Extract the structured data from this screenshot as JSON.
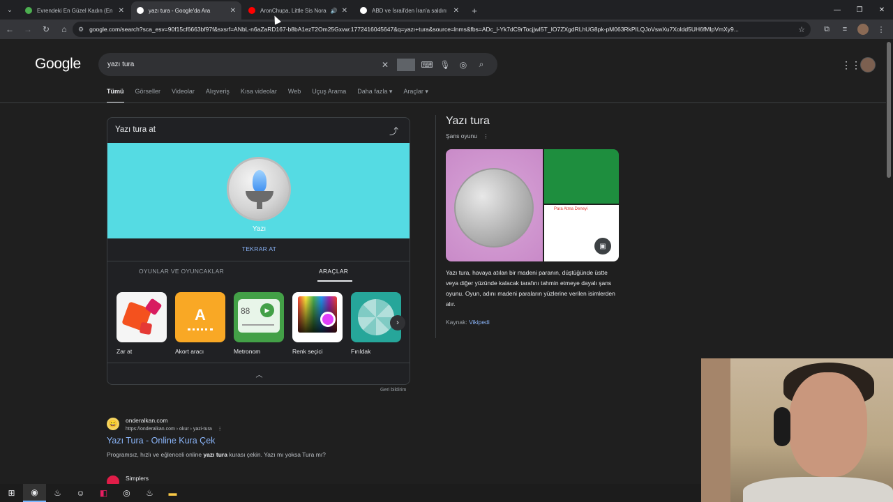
{
  "browser": {
    "tabs": [
      {
        "title": "Evrendeki En Güzel Kadın (En G",
        "favicon_color": "#4caf50",
        "active": false
      },
      {
        "title": "yazı tura - Google'da Ara",
        "favicon_color": "#ffffff",
        "active": true
      },
      {
        "title": "AronChupa, Little Sis Nora",
        "favicon_color": "#ff0000",
        "active": false,
        "audio": true
      },
      {
        "title": "ABD ve İsrail'den İran'a saldırı",
        "favicon_color": "#ffffff",
        "active": false
      }
    ],
    "url": "google.com/search?sca_esv=90f15cf6663bf97f&sxsrf=ANbL-n6aZaRD167-b8bA1ezT2Om25Gxvw:1772416045647&q=yazı+tura&source=lnms&fbs=ADc_l-Yk7dC9rTocjjwI5T_IO7ZXgdRLhUG8pk-pM063RkPILQJoVswXu7Xoldd5UH6fMIpVmXy9..."
  },
  "google": {
    "logo": "Google",
    "query": "yazı tura",
    "nav_tabs": [
      "Tümü",
      "Görseller",
      "Videolar",
      "Alışveriş",
      "Kısa videolar",
      "Web",
      "Uçuş Arama",
      "Daha fazla ▾",
      "Araçlar ▾"
    ]
  },
  "coin_card": {
    "title": "Yazı tura at",
    "result_label": "Yazı",
    "again_button": "TEKRAR AT",
    "tabs": [
      "OYUNLAR VE OYUNCAKLAR",
      "ARAÇLAR"
    ],
    "tools": [
      {
        "label": "Zar at",
        "icon": "dice-icon",
        "bg": "#f5f5f5"
      },
      {
        "label": "Akort aracı",
        "icon": "tuner-icon",
        "bg": "#f9a825",
        "glyph": "A"
      },
      {
        "label": "Metronom",
        "icon": "metronome-icon",
        "bg": "#43a047",
        "glyph": "88"
      },
      {
        "label": "Renk seçici",
        "icon": "color-picker-icon",
        "bg": "#ffffff"
      },
      {
        "label": "Fırıldak",
        "icon": "spinner-icon",
        "bg": "#26a69a"
      }
    ],
    "feedback": "Geri bildirim"
  },
  "result": {
    "site": "onderalkan.com",
    "url": "https://onderalkan.com › okur › yazi-tura",
    "title": "Yazı Tura - Online Kura Çek",
    "snippet_pre": "Programsız, hızlı ve eğlenceli online ",
    "snippet_bold": "yazı tura",
    "snippet_post": " kurası çekin. Yazı mı yoksa Tura mı?",
    "next_site": "Simplers"
  },
  "knowledge_panel": {
    "title": "Yazı tura",
    "subtitle": "Şans oyunu",
    "image_caption": "Para Atma Deneyi",
    "description": "Yazı tura, havaya atılan bir madeni paranın, düştüğünde üstte veya diğer yüzünde kalacak tarafını tahmin etmeye dayalı şans oyunu. Oyun, adını madeni paraların yüzlerine verilen isimlerden alır.",
    "source_label": "Kaynak:",
    "source_link": "Vikipedi"
  },
  "taskbar": {
    "apps": [
      "windows-start-icon",
      "chrome-icon",
      "steam-icon",
      "discord-icon",
      "app-icon",
      "obs-icon",
      "steam-icon-2",
      "file-explorer-icon"
    ]
  }
}
